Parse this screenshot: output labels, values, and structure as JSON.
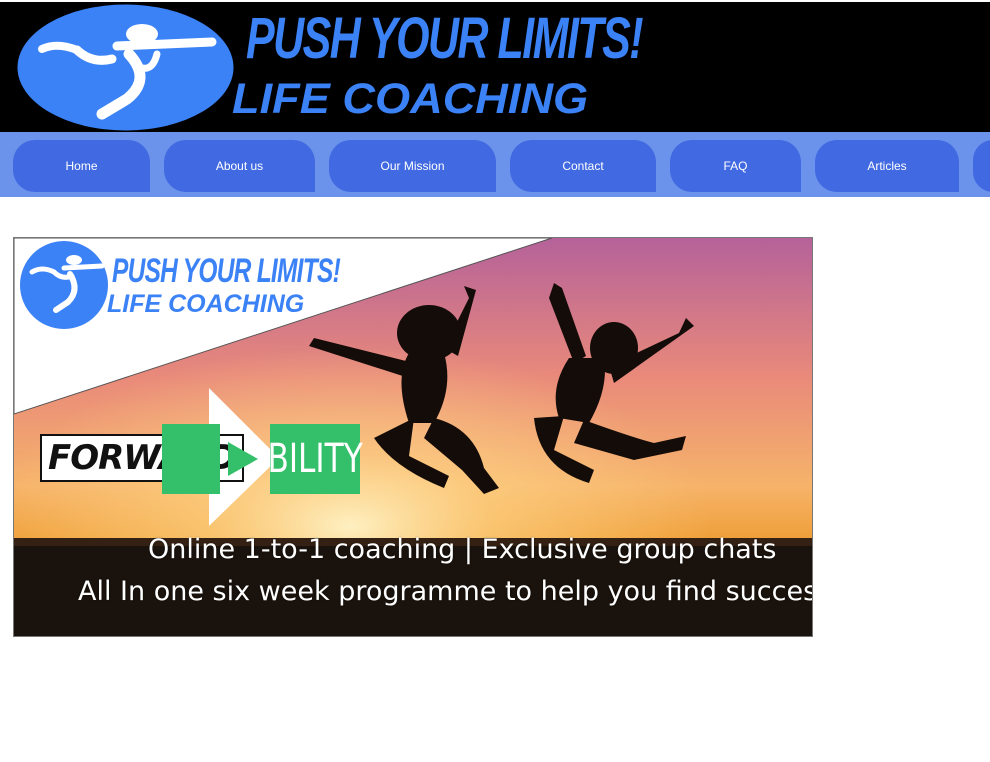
{
  "brand": {
    "title_line1": "PUSH YOUR LIMITS!",
    "title_line2": "LIFE COACHING"
  },
  "nav": {
    "items": [
      {
        "label": "Home"
      },
      {
        "label": "About us"
      },
      {
        "label": "Our Mission"
      },
      {
        "label": "Contact"
      },
      {
        "label": "FAQ"
      },
      {
        "label": "Articles"
      }
    ]
  },
  "banner": {
    "logo_line1": "PUSH YOUR LIMITS!",
    "logo_line2": "LIFE COACHING",
    "programme_word1": "FORWARD",
    "programme_word2": "BILITY",
    "tagline1": "Online 1-to-1 coaching | Exclusive group chats",
    "tagline2": "All In one six week programme to help you find success."
  },
  "colors": {
    "header_bg": "#000000",
    "brand_blue": "#3b82f6",
    "nav_bg": "#6b93eb",
    "nav_item": "#4169e1",
    "accent_green": "#34c06a"
  },
  "icons": {
    "logo": "running-figure-icon",
    "arrow": "play-arrow-icon"
  }
}
